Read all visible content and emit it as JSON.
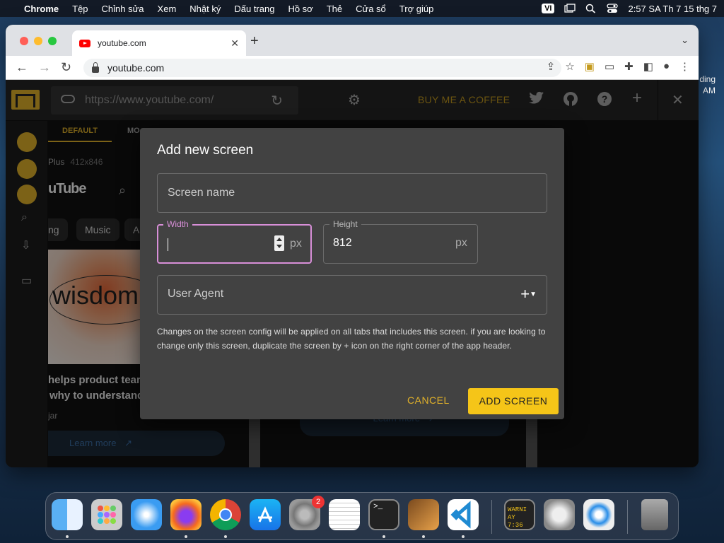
{
  "menubar": {
    "items": [
      "Chrome",
      "Tệp",
      "Chỉnh sửa",
      "Xem",
      "Nhật ký",
      "Dấu trang",
      "Hồ sơ",
      "Thẻ",
      "Cửa sổ",
      "Trợ giúp"
    ],
    "input_source": "VI",
    "clock": "2:57 SA Th 7 15 thg 7"
  },
  "side_clock": {
    "line1": "ding",
    "line2": "AM"
  },
  "browser": {
    "tab_title": "youtube.com",
    "address": "youtube.com"
  },
  "app": {
    "url_value": "https://www.youtube.com/",
    "buy_coffee": "BUY ME A COFFEE",
    "tabs": {
      "default": "DEFAULT",
      "second": "MO"
    },
    "device": {
      "name": "Plus",
      "size": "412x846"
    },
    "preview": {
      "logo_text": "uTube",
      "chips": [
        "ng",
        "Music",
        "A"
      ],
      "thumb_text": "wisdom",
      "title_line1": "helps product tear",
      "title_line2": "why to understand",
      "channel": "jar",
      "learn_more": "Learn more"
    }
  },
  "dialog": {
    "title": "Add new screen",
    "screen_name_placeholder": "Screen name",
    "width_label": "Width",
    "width_value": "",
    "height_label": "Height",
    "height_value": "812",
    "unit": "px",
    "user_agent_placeholder": "User Agent",
    "help_text": "Changes on the screen config will be applied on all tabs that includes this screen. if you are looking to change only this screen, duplicate the screen by + icon on the right corner of the app header.",
    "cancel_label": "CANCEL",
    "add_label": "ADD SCREEN"
  },
  "dock": {
    "apps": [
      "finder-icon",
      "launchpad-icon",
      "safari-icon",
      "firefox-icon",
      "chrome-icon",
      "app-store-icon",
      "system-settings-icon",
      "textedit-icon",
      "terminal-icon",
      "garageband-icon",
      "vscode-icon",
      "console-icon",
      "automator-icon",
      "quicktime-icon",
      "trash-icon"
    ],
    "settings_badge": "2",
    "console_text": "WARNI AY 7:36"
  },
  "colors": {
    "accent": "#f5c518",
    "focus": "#d88fd8",
    "dialog_bg": "#424242"
  }
}
